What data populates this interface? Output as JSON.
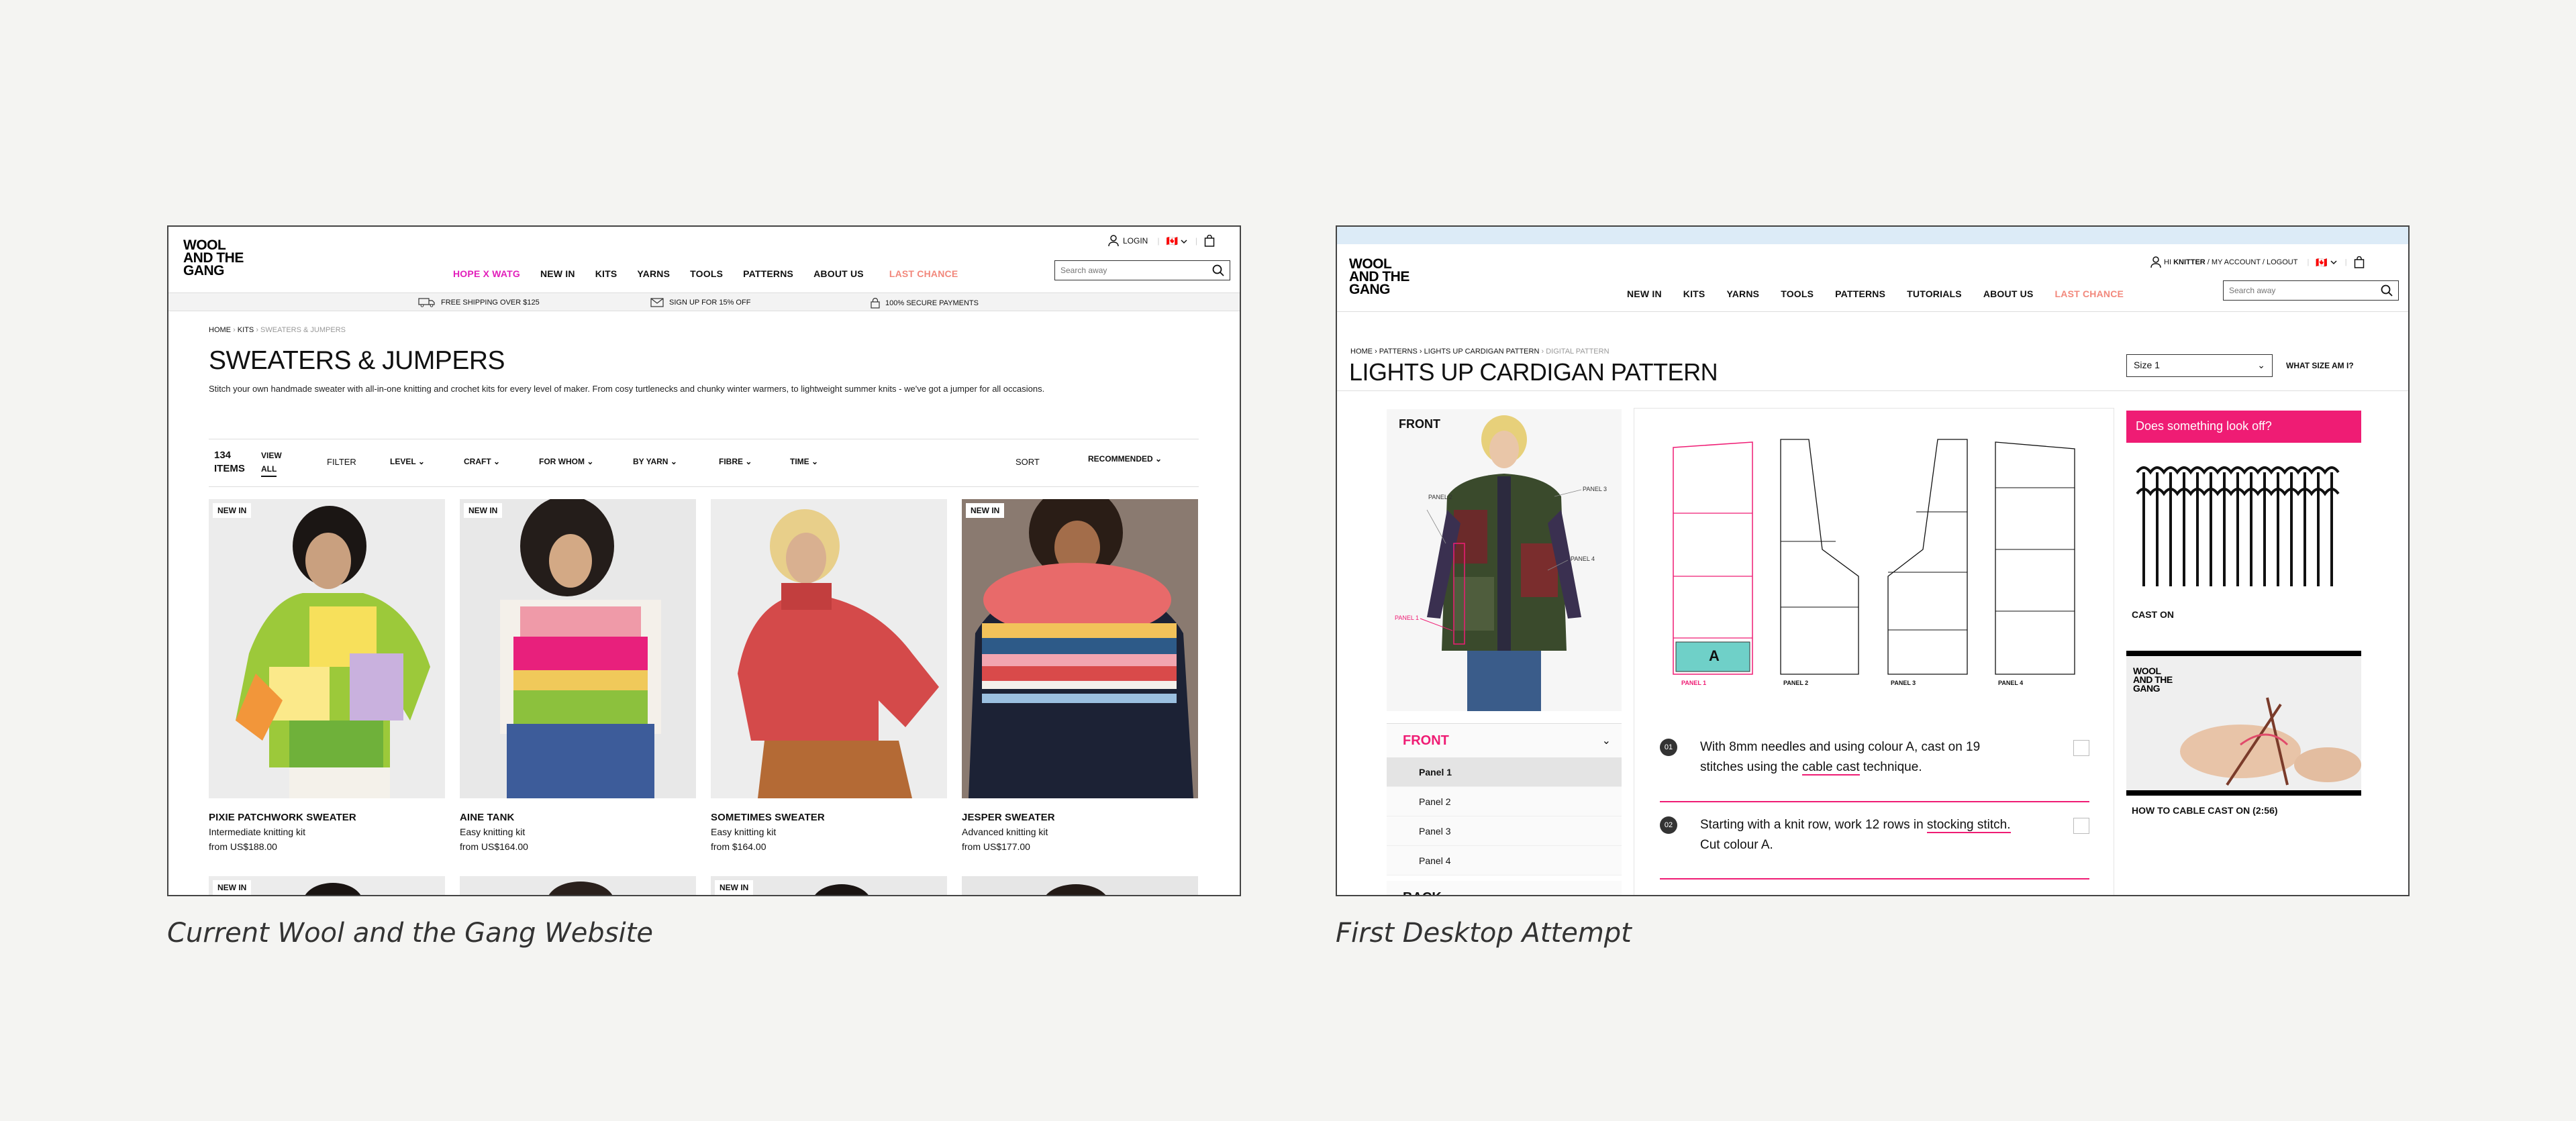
{
  "captions": {
    "left": "Current Wool and the Gang Website",
    "right": "First Desktop Attempt"
  },
  "colors": {
    "pink": "#ef1c74",
    "magenta": "#e21fbb",
    "salmon": "#f2887c"
  },
  "site1": {
    "logo": [
      "WOOL",
      "AND THE",
      "GANG"
    ],
    "login": "LOGIN",
    "flag": "🇨🇦",
    "nav": [
      "HOPE X WATG",
      "NEW IN",
      "KITS",
      "YARNS",
      "TOOLS",
      "PATTERNS",
      "ABOUT US",
      "LAST CHANCE"
    ],
    "search_placeholder": "Search away",
    "shipbar": [
      "FREE SHIPPING OVER $125",
      "SIGN UP FOR 15% OFF",
      "100% SECURE PAYMENTS"
    ],
    "breadcrumb": {
      "home": "HOME",
      "kits": "KITS",
      "current": "SWEATERS & JUMPERS"
    },
    "title": "SWEATERS & JUMPERS",
    "description": "Stitch your own handmade sweater with all-in-one knitting and crochet kits for every level of maker. From cosy turtlenecks and chunky winter warmers, to lightweight summer knits - we've got a jumper for all occasions.",
    "count": [
      "134",
      "ITEMS"
    ],
    "view_all": [
      "VIEW",
      "ALL"
    ],
    "filter": "FILTER",
    "filters": [
      "LEVEL",
      "CRAFT",
      "FOR WHOM",
      "BY YARN",
      "FIBRE",
      "TIME"
    ],
    "sort": "SORT",
    "sort_value": "RECOMMENDED",
    "badge": "NEW IN",
    "products": [
      {
        "name": "PIXIE PATCHWORK SWEATER",
        "sub": "Intermediate knitting kit",
        "price": "from US$188.00",
        "new": true
      },
      {
        "name": "AINE TANK",
        "sub": "Easy knitting kit",
        "price": "from US$164.00",
        "new": true
      },
      {
        "name": "SOMETIMES SWEATER",
        "sub": "Easy knitting kit",
        "price": "from $164.00",
        "new": false
      },
      {
        "name": "JESPER SWEATER",
        "sub": "Advanced knitting kit",
        "price": "from US$177.00",
        "new": true
      }
    ]
  },
  "site2": {
    "logo": [
      "WOOL",
      "AND THE",
      "GANG"
    ],
    "greeting_prefix": "HI ",
    "greeting_name": "KNITTER",
    "account_links": " / MY ACCOUNT / LOGOUT",
    "nav": [
      "NEW IN",
      "KITS",
      "YARNS",
      "TOOLS",
      "PATTERNS",
      "TUTORIALS",
      "ABOUT US",
      "LAST CHANCE"
    ],
    "search_placeholder": "Search away",
    "breadcrumb": [
      "HOME",
      "PATTERNS",
      "LIGHTS UP CARDIGAN PATTERN",
      "DIGITAL PATTERN"
    ],
    "title": "LIGHTS UP CARDIGAN PATTERN",
    "size_select": "Size 1",
    "size_link": "WHAT SIZE AM I?",
    "front_label": "FRONT",
    "photo_panels": [
      "PANEL 2",
      "PANEL 3",
      "PANEL 4",
      "PANEL 1"
    ],
    "accordion": {
      "front": "FRONT",
      "items": [
        "Panel 1",
        "Panel 2",
        "Panel 3",
        "Panel 4"
      ],
      "back": "BACK"
    },
    "schematic_labels": [
      "PANEL 1",
      "PANEL 2",
      "PANEL 3",
      "PANEL 4"
    ],
    "schematic_letter": "A",
    "steps": [
      {
        "num": "01",
        "pre": "With 8mm needles and using colour A, cast on 19 stitches using the ",
        "link": "cable cast",
        "post": " technique."
      },
      {
        "num": "02",
        "pre": "Starting with a knit row, work 12 rows in ",
        "link": "stocking stitch.",
        "post": " Cut colour A."
      }
    ],
    "help_banner": "Does something look off?",
    "cast_on": "CAST ON",
    "video_title": "HOW TO CABLE CAST ON (2:56)"
  }
}
